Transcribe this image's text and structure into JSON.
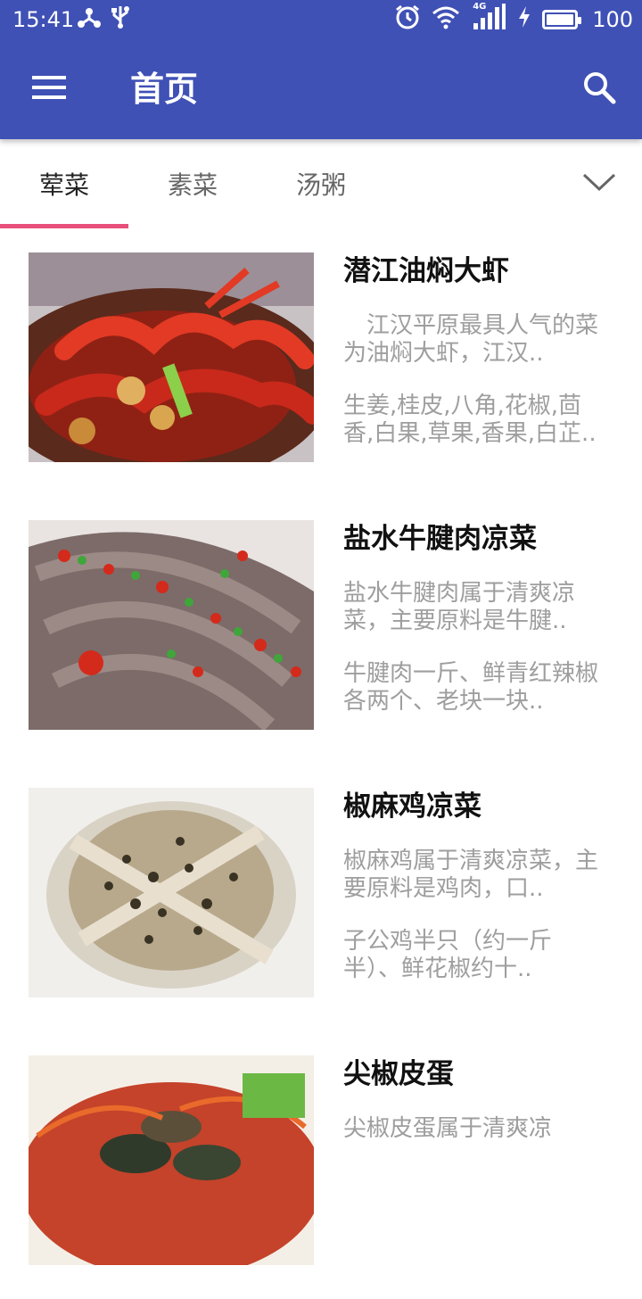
{
  "status_bar": {
    "time": "15:41",
    "battery_level": "100",
    "battery_fraction": 1.0,
    "network": "4G",
    "icons": [
      "network-share-icon",
      "usb-icon",
      "alarm-icon",
      "wifi-icon",
      "signal-icon",
      "charging-icon",
      "battery-icon"
    ]
  },
  "app_bar": {
    "title": "首页",
    "background_color": "#3f51b5",
    "menu_icon": "menu-icon",
    "search_icon": "search-icon"
  },
  "tabs": {
    "items": [
      {
        "label": "荤菜",
        "active": true
      },
      {
        "label": "素菜",
        "active": false
      },
      {
        "label": "汤粥",
        "active": false
      }
    ],
    "indicator_color": "#e8507a",
    "expand_icon": "chevron-down-icon"
  },
  "recipes": [
    {
      "title": "潜江油焖大虾",
      "description": "　江汉平原最具人气的菜为油焖大虾，江汉..",
      "ingredients": "生姜,桂皮,八角,花椒,茴香,白果,草果,香果,白芷.."
    },
    {
      "title": "盐水牛腱肉凉菜",
      "description": "盐水牛腱肉属于清爽凉菜，主要原料是牛腱..",
      "ingredients": "牛腱肉一斤、鲜青红辣椒各两个、老块一块.."
    },
    {
      "title": "椒麻鸡凉菜",
      "description": "椒麻鸡属于清爽凉菜，主要原料是鸡肉，口..",
      "ingredients": "子公鸡半只（约一斤半）、鲜花椒约十.."
    },
    {
      "title": "尖椒皮蛋",
      "description": "尖椒皮蛋属于清爽凉",
      "ingredients": ""
    }
  ]
}
